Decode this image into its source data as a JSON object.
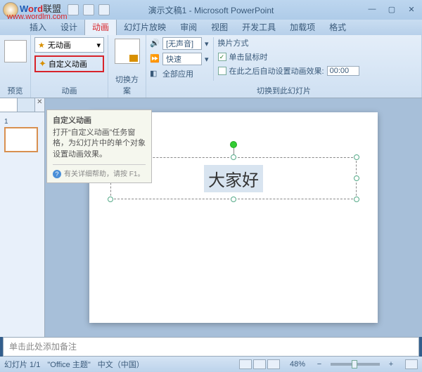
{
  "window": {
    "title": "演示文稿1 - Microsoft PowerPoint"
  },
  "watermark": {
    "brand_w": "W",
    "brand_o": "o",
    "brand_r": "r",
    "brand_d": "d",
    "brand_cn": "联盟",
    "url": "www.wordlm.com"
  },
  "tabs": {
    "insert": "插入",
    "design": "设计",
    "anim": "动画",
    "slideshow": "幻灯片放映",
    "review": "审阅",
    "view": "视图",
    "dev": "开发工具",
    "addin": "加载项",
    "format": "格式"
  },
  "ribbon": {
    "preview": {
      "label": "预览"
    },
    "anim_group": {
      "label": "动画",
      "none": "无动画",
      "custom": "自定义动画"
    },
    "trans": {
      "label": "切换方案"
    },
    "switch": {
      "label": "切换到此幻灯片",
      "sound_icon": "🔊",
      "sound": "[无声音]",
      "speed_icon": "⏩",
      "speed": "快速",
      "apply_all_icon": "◧",
      "apply_all": "全部应用",
      "method_label": "换片方式",
      "on_click": "单击鼠标时",
      "auto_after": "在此之后自动设置动画效果:",
      "time": "00:00"
    }
  },
  "tooltip": {
    "title": "自定义动画",
    "body": "打开“自定义动画”任务窗格，为幻灯片中的单个对象设置动画效果。",
    "help": "有关详细帮助，请按 F1。"
  },
  "slide": {
    "text": "大家好"
  },
  "notes": {
    "placeholder": "单击此处添加备注"
  },
  "status": {
    "slide_num": "幻灯片 1/1",
    "theme": "\"Office 主题\"",
    "lang": "中文（中国）",
    "zoom": "48%",
    "minus": "−",
    "plus": "+"
  }
}
